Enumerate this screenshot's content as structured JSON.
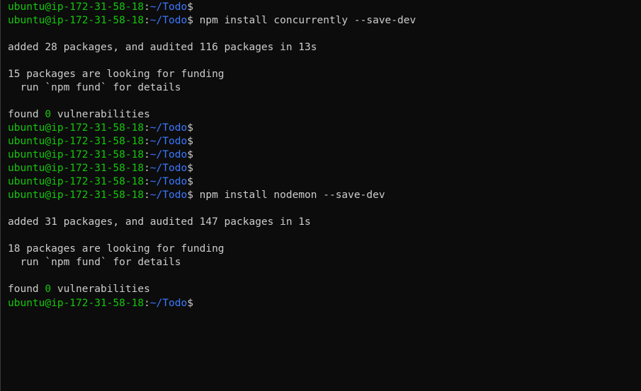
{
  "prompt": {
    "user_host": "ubuntu@ip-172-31-58-18",
    "sep": ":",
    "path": "~/Todo",
    "symbol": "$"
  },
  "lines": [
    {
      "type": "prompt",
      "cmd": ""
    },
    {
      "type": "prompt",
      "cmd": " npm install concurrently --save-dev"
    },
    {
      "type": "blank"
    },
    {
      "type": "text",
      "text": "added 28 packages, and audited 116 packages in 13s"
    },
    {
      "type": "blank"
    },
    {
      "type": "text",
      "text": "15 packages are looking for funding"
    },
    {
      "type": "text",
      "text": "  run `npm fund` for details"
    },
    {
      "type": "blank"
    },
    {
      "type": "vuln",
      "before": "found ",
      "count": "0",
      "after": " vulnerabilities"
    },
    {
      "type": "prompt",
      "cmd": ""
    },
    {
      "type": "prompt",
      "cmd": ""
    },
    {
      "type": "prompt",
      "cmd": ""
    },
    {
      "type": "prompt",
      "cmd": ""
    },
    {
      "type": "prompt",
      "cmd": ""
    },
    {
      "type": "prompt",
      "cmd": " npm install nodemon --save-dev"
    },
    {
      "type": "blank"
    },
    {
      "type": "text",
      "text": "added 31 packages, and audited 147 packages in 1s"
    },
    {
      "type": "blank"
    },
    {
      "type": "text",
      "text": "18 packages are looking for funding"
    },
    {
      "type": "text",
      "text": "  run `npm fund` for details"
    },
    {
      "type": "blank"
    },
    {
      "type": "vuln",
      "before": "found ",
      "count": "0",
      "after": " vulnerabilities"
    },
    {
      "type": "prompt",
      "cmd": ""
    }
  ],
  "colors": {
    "background": "#0c0c0c",
    "text": "#cccccc",
    "user_host": "#16c60c",
    "path": "#3b78ff",
    "zero_count": "#16c60c"
  }
}
